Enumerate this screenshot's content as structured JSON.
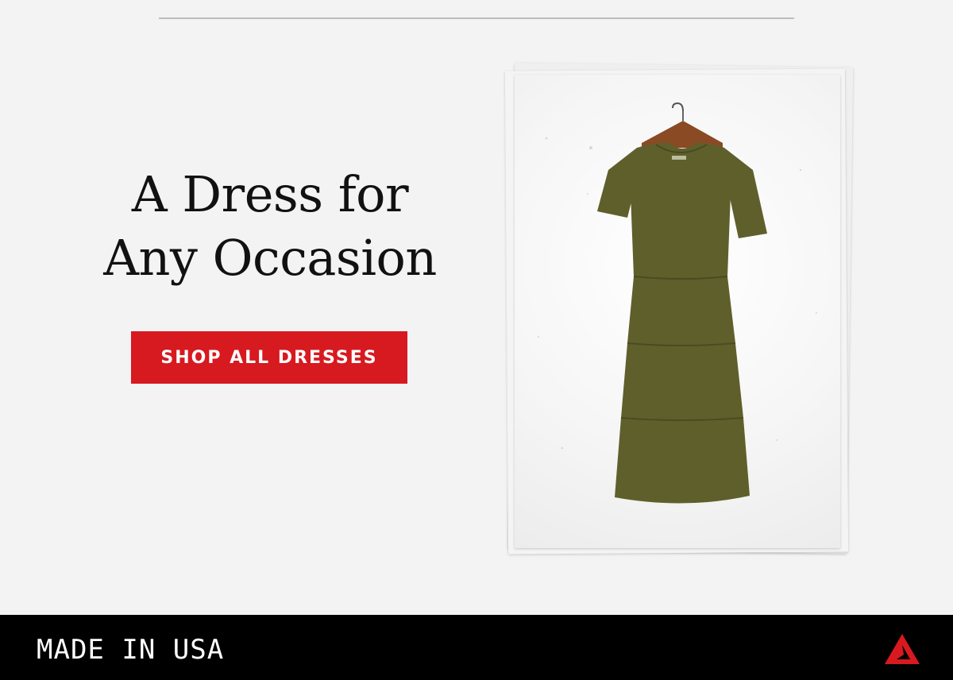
{
  "headline": {
    "line1": "A Dress for",
    "line2": "Any Occasion"
  },
  "cta": {
    "label": "SHOP ALL DRESSES"
  },
  "product": {
    "icon": "dress-image",
    "color": "#5f5f2c"
  },
  "footer": {
    "text": "MADE IN USA",
    "logo_icon": "brand-triangle-logo-icon",
    "logo_color": "#d71920"
  },
  "colors": {
    "background": "#f3f3f3",
    "accent": "#d71920",
    "footer": "#000000"
  }
}
